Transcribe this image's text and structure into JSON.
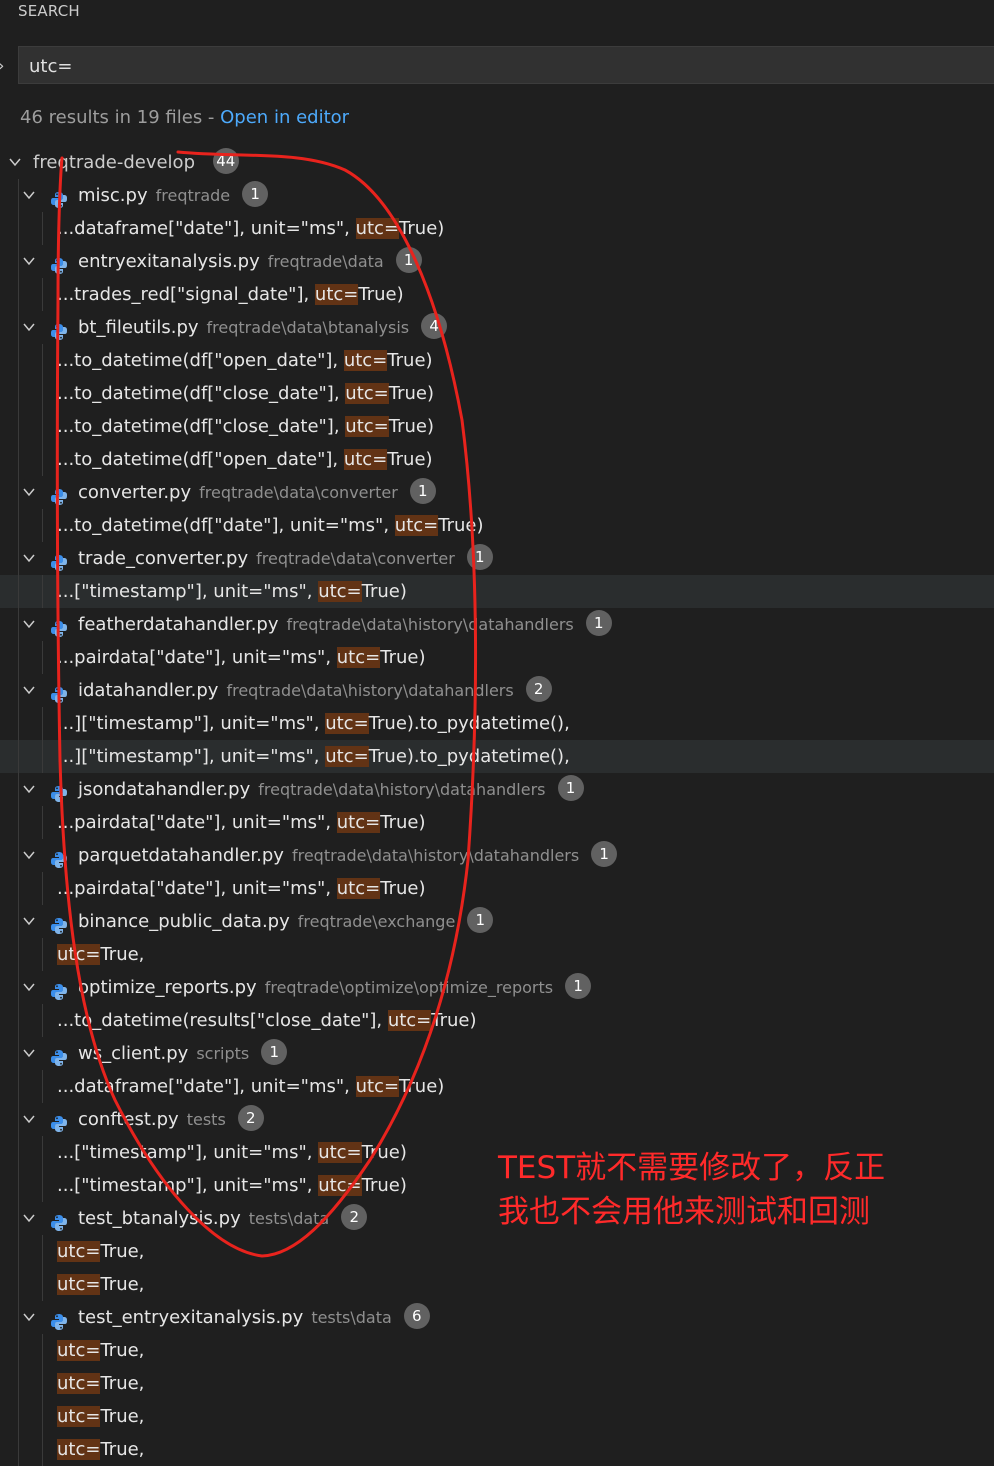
{
  "panel": {
    "title": "SEARCH"
  },
  "search": {
    "query": "utc="
  },
  "summary": {
    "count_text": "46 results in 19 files - ",
    "open_editor_label": "Open in editor"
  },
  "tree": {
    "root_label": "freqtrade-develop",
    "root_count": "44",
    "files": [
      {
        "name": "misc.py",
        "path": "freqtrade",
        "count": "1",
        "matches": [
          {
            "pre": "...dataframe[\"date\"], unit=\"ms\", ",
            "hit": "utc=",
            "post": "True)"
          }
        ]
      },
      {
        "name": "entryexitanalysis.py",
        "path": "freqtrade\\data",
        "count": "1",
        "matches": [
          {
            "pre": "...trades_red[\"signal_date\"], ",
            "hit": "utc=",
            "post": "True)"
          }
        ]
      },
      {
        "name": "bt_fileutils.py",
        "path": "freqtrade\\data\\btanalysis",
        "count": "4",
        "matches": [
          {
            "pre": "...to_datetime(df[\"open_date\"], ",
            "hit": "utc=",
            "post": "True)"
          },
          {
            "pre": "...to_datetime(df[\"close_date\"], ",
            "hit": "utc=",
            "post": "True)"
          },
          {
            "pre": "...to_datetime(df[\"close_date\"], ",
            "hit": "utc=",
            "post": "True)"
          },
          {
            "pre": "...to_datetime(df[\"open_date\"], ",
            "hit": "utc=",
            "post": "True)"
          }
        ]
      },
      {
        "name": "converter.py",
        "path": "freqtrade\\data\\converter",
        "count": "1",
        "matches": [
          {
            "pre": "...to_datetime(df[\"date\"], unit=\"ms\", ",
            "hit": "utc=",
            "post": "True)"
          }
        ]
      },
      {
        "name": "trade_converter.py",
        "path": "freqtrade\\data\\converter",
        "count": "1",
        "matches": [
          {
            "pre": "...[\"timestamp\"], unit=\"ms\", ",
            "hit": "utc=",
            "post": "True)",
            "highlighted": true
          }
        ]
      },
      {
        "name": "featherdatahandler.py",
        "path": "freqtrade\\data\\history\\datahandlers",
        "count": "1",
        "matches": [
          {
            "pre": "...pairdata[\"date\"], unit=\"ms\", ",
            "hit": "utc=",
            "post": "True)"
          }
        ]
      },
      {
        "name": "idatahandler.py",
        "path": "freqtrade\\data\\history\\datahandlers",
        "count": "2",
        "matches": [
          {
            "pre": "...][\"timestamp\"], unit=\"ms\", ",
            "hit": "utc=",
            "post": "True).to_pydatetime(),"
          },
          {
            "pre": "...][\"timestamp\"], unit=\"ms\", ",
            "hit": "utc=",
            "post": "True).to_pydatetime(),",
            "highlighted": true
          }
        ]
      },
      {
        "name": "jsondatahandler.py",
        "path": "freqtrade\\data\\history\\datahandlers",
        "count": "1",
        "matches": [
          {
            "pre": "...pairdata[\"date\"], unit=\"ms\", ",
            "hit": "utc=",
            "post": "True)"
          }
        ]
      },
      {
        "name": "parquetdatahandler.py",
        "path": "freqtrade\\data\\history\\datahandlers",
        "count": "1",
        "matches": [
          {
            "pre": "...pairdata[\"date\"], unit=\"ms\", ",
            "hit": "utc=",
            "post": "True)"
          }
        ]
      },
      {
        "name": "binance_public_data.py",
        "path": "freqtrade\\exchange",
        "count": "1",
        "matches": [
          {
            "pre": "",
            "hit": "utc=",
            "post": "True,"
          }
        ]
      },
      {
        "name": "optimize_reports.py",
        "path": "freqtrade\\optimize\\optimize_reports",
        "count": "1",
        "matches": [
          {
            "pre": "...to_datetime(results[\"close_date\"], ",
            "hit": "utc=",
            "post": "True)"
          }
        ]
      },
      {
        "name": "ws_client.py",
        "path": "scripts",
        "count": "1",
        "matches": [
          {
            "pre": "...dataframe[\"date\"], unit=\"ms\", ",
            "hit": "utc=",
            "post": "True)"
          }
        ]
      },
      {
        "name": "conftest.py",
        "path": "tests",
        "count": "2",
        "matches": [
          {
            "pre": "...[\"timestamp\"], unit=\"ms\", ",
            "hit": "utc=",
            "post": "True)"
          },
          {
            "pre": "...[\"timestamp\"], unit=\"ms\", ",
            "hit": "utc=",
            "post": "True)"
          }
        ]
      },
      {
        "name": "test_btanalysis.py",
        "path": "tests\\data",
        "count": "2",
        "matches": [
          {
            "pre": "",
            "hit": "utc=",
            "post": "True,"
          },
          {
            "pre": "",
            "hit": "utc=",
            "post": "True,"
          }
        ]
      },
      {
        "name": "test_entryexitanalysis.py",
        "path": "tests\\data",
        "count": "6",
        "matches": [
          {
            "pre": "",
            "hit": "utc=",
            "post": "True,"
          },
          {
            "pre": "",
            "hit": "utc=",
            "post": "True,"
          },
          {
            "pre": "",
            "hit": "utc=",
            "post": "True,"
          },
          {
            "pre": "",
            "hit": "utc=",
            "post": "True,"
          }
        ]
      }
    ]
  },
  "annotation": {
    "lines": [
      "TEST就不需要修改了，反正",
      "我也不会用他来测试和回测"
    ],
    "color": "#ff2a2a"
  },
  "colors": {
    "background": "#1f1f1f",
    "match_highlight": "#623315",
    "link": "#4daafc",
    "badge": "#616161"
  },
  "icons": {
    "chevron": "chevron-down-icon",
    "file": "python-file-icon",
    "replace_toggle": "chevron-right-icon"
  }
}
